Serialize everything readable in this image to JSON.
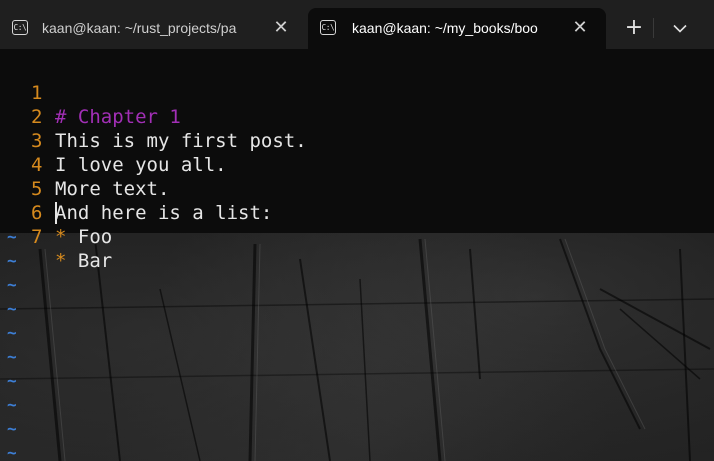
{
  "tabs": [
    {
      "title": "kaan@kaan: ~/rust_projects/pa",
      "icon": "terminal-icon",
      "icon_glyph": "C:\\",
      "active": false
    },
    {
      "title": "kaan@kaan: ~/my_books/boo",
      "icon": "terminal-icon",
      "icon_glyph": "C:\\",
      "active": true
    }
  ],
  "tab_controls": {
    "new_tab": "+",
    "close": "✕",
    "dropdown_icon": "chevron-down-icon"
  },
  "editor": {
    "lines": [
      {
        "number": "1",
        "text": "# Chapter 1"
      },
      {
        "number": "2",
        "text": "This is my first post."
      },
      {
        "number": "3",
        "text": "I love you all."
      },
      {
        "number": "4",
        "text": "More text."
      },
      {
        "number": "5",
        "text": "And here is a list:"
      },
      {
        "number": "6",
        "bullet": "*",
        "text": " Foo"
      },
      {
        "number": "7",
        "bullet": "*",
        "text": " Bar"
      }
    ],
    "empty_line_marker": "~",
    "colors": {
      "line_number": "#d68a1e",
      "heading": "#a22fb6",
      "text": "#e6e6e6",
      "tilde": "#3d7fd6",
      "background": "#0c0c0c"
    }
  }
}
